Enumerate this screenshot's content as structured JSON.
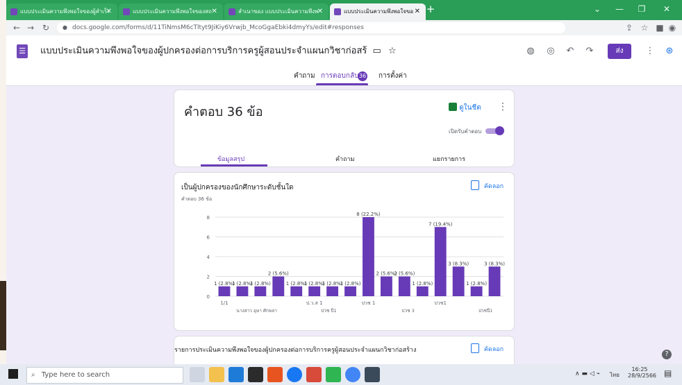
{
  "browser": {
    "tabs": [
      {
        "title": "แบบประเมินความพึงพอใจของผู้สำเร็จฯ",
        "active": false
      },
      {
        "title": "แบบประเมินความพึงพอใจของสถานประ",
        "active": false
      },
      {
        "title": "สำเนาของ แบบประเมินความพึงพอใจ",
        "active": false
      },
      {
        "title": "แบบประเมินความพึงพอใจของผู้ปกครอง",
        "active": true
      }
    ],
    "new_tab_label": "+",
    "url": "docs.google.com/forms/d/11TiNmsM6cTltyt9JiKiy6Vrwjb_McoGgaEbki4dmyYs/edit#responses"
  },
  "form": {
    "title": "แบบประเมินความพึงพอใจของผู้ปกครองต่อการบริการครูผู้สอนประจำแผนกวิชาก่อสร้",
    "send_label": "ส่ง",
    "tabs": {
      "questions": "คำถาม",
      "responses": "การตอบกลับ",
      "responses_count": "36",
      "settings": "การตั้งค่า"
    }
  },
  "responses_card": {
    "title": "คำตอบ 36 ข้อ",
    "sheets_link": "ดูในชีต",
    "accepting_label": "เปิดรับคำตอบ",
    "accepting": true,
    "subtabs": {
      "summary": "ข้อมูลสรุป",
      "question": "คำถาม",
      "individual": "แยกรายการ"
    }
  },
  "question_card": {
    "title": "เป็นผู้ปกครองของนักศึกษาระดับชั้นใด",
    "subtitle": "คำตอบ 36 ข้อ",
    "copy_label": "คัดลอก"
  },
  "chart_data": {
    "type": "bar",
    "ylim": [
      0,
      8
    ],
    "yticks": [
      0,
      2,
      4,
      6,
      8
    ],
    "values": [
      1,
      1,
      1,
      2,
      1,
      1,
      1,
      1,
      8,
      2,
      2,
      1,
      7,
      3,
      1,
      3
    ],
    "labels": [
      "1 (2.8%)",
      "1 (2.8%)",
      "1 (2.8%)",
      "2 (5.6%)",
      "1 (2.8%)",
      "1 (2.8%)",
      "1 (2.8%)",
      "1 (2.8%)",
      "8 (22.2%)",
      "2 (5.6%)",
      "2 (5.6%)",
      "1 (2.8%)",
      "7 (19.4%)",
      "3 (8.3%)",
      "1 (2.8%)",
      "3 (8.3%)"
    ],
    "xticks_row1": [
      "1/1",
      "ป.ว.ส 1",
      "ปวช 1",
      "ปวช1"
    ],
    "xticks_row2": [
      "นางสาว อุษา ศักพลา",
      "ปวช ปี1",
      "ปวช 3",
      "ปวชปี1"
    ],
    "bar_color": "#673ab7"
  },
  "next_card": {
    "title": "รายการประเมินความพึงพอใจของผู้ปกครองต่อการบริการครูผู้สอนประจำแผนกวิชาก่อสร้าง",
    "copy_label": "คัดลอก"
  },
  "taskbar": {
    "search_placeholder": "Type here to search",
    "time": "16:25",
    "date": "28/9/2566",
    "lang": "ไทย"
  }
}
